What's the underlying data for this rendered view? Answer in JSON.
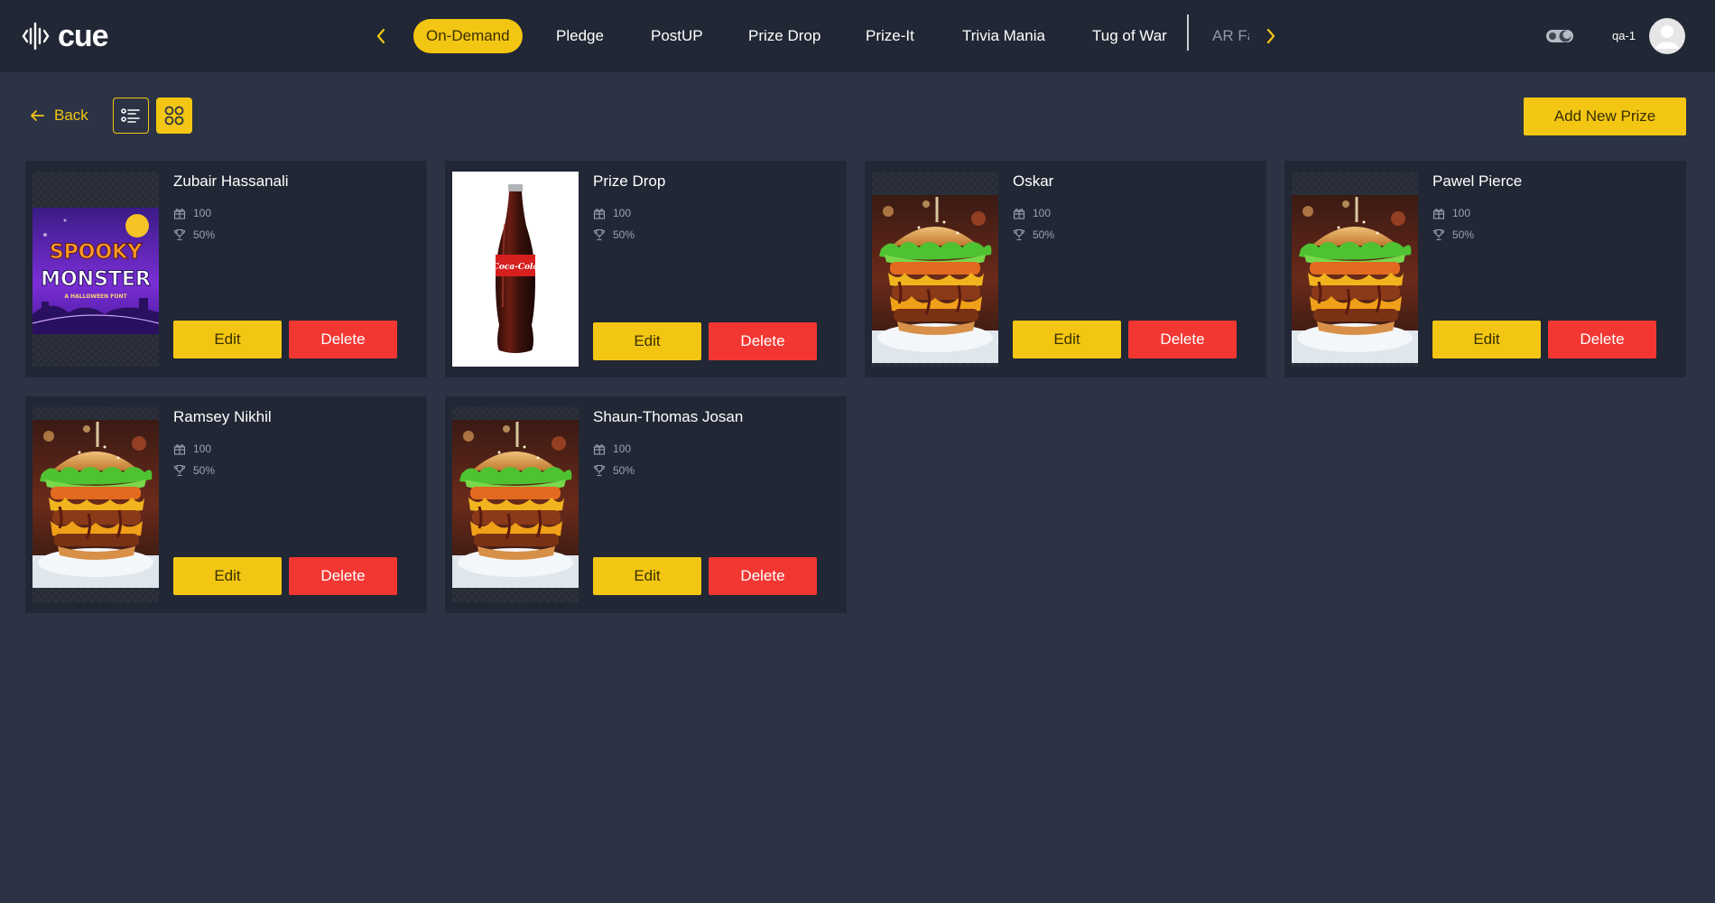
{
  "app": {
    "logo_text": "cue",
    "colors": {
      "accent": "#f3c613",
      "danger": "#f23732",
      "topbar": "#212734",
      "background": "#2b3344",
      "card": "#212734"
    }
  },
  "nav": {
    "tabs": [
      {
        "label": "On-Demand",
        "active": true
      },
      {
        "label": "Pledge"
      },
      {
        "label": "PostUP"
      },
      {
        "label": "Prize Drop"
      },
      {
        "label": "Prize-It"
      },
      {
        "label": "Trivia Mania"
      },
      {
        "label": "Tug of War"
      },
      {
        "label": "AR Fa",
        "faded": true
      }
    ],
    "prev_icon": "chevron-left-icon",
    "next_icon": "chevron-right-icon"
  },
  "user": {
    "name": "qa-1",
    "theme_toggle_icon": "theme-toggle-icon",
    "avatar_icon": "user-avatar-icon"
  },
  "toolbar": {
    "back_label": "Back",
    "list_view_icon": "list-view-icon",
    "grid_view_icon": "grid-view-icon",
    "active_view": "grid",
    "add_label": "Add New Prize"
  },
  "prizes": [
    {
      "title": "Zubair Hassanali",
      "quantity": "100",
      "probability": "50%",
      "image": "spooky-monster-poster",
      "poster_text": [
        "SPOOKY",
        "MONSTER",
        "A HALLOWEEN FONT"
      ],
      "edit_label": "Edit",
      "delete_label": "Delete"
    },
    {
      "title": "Prize Drop",
      "quantity": "100",
      "probability": "50%",
      "image": "cola-bottle",
      "bottle_text": "Coca-Cola",
      "edit_label": "Edit",
      "delete_label": "Delete"
    },
    {
      "title": "Oskar",
      "quantity": "100",
      "probability": "50%",
      "image": "burger",
      "edit_label": "Edit",
      "delete_label": "Delete"
    },
    {
      "title": "Pawel Pierce",
      "quantity": "100",
      "probability": "50%",
      "image": "burger",
      "edit_label": "Edit",
      "delete_label": "Delete"
    },
    {
      "title": "Ramsey Nikhil",
      "quantity": "100",
      "probability": "50%",
      "image": "burger",
      "edit_label": "Edit",
      "delete_label": "Delete"
    },
    {
      "title": "Shaun-Thomas Josan",
      "quantity": "100",
      "probability": "50%",
      "image": "burger",
      "edit_label": "Edit",
      "delete_label": "Delete"
    }
  ]
}
